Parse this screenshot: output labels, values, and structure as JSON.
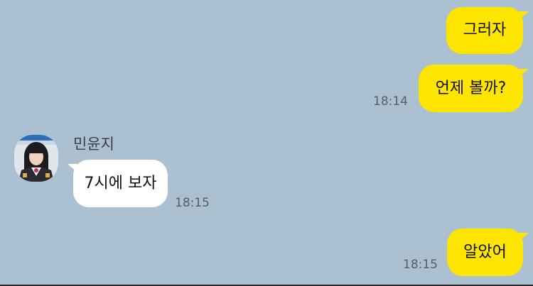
{
  "messages": {
    "m1": {
      "text": "그러자"
    },
    "m2": {
      "text": "언제 볼까?",
      "time": "18:14"
    },
    "m3": {
      "sender": "민윤지",
      "text": "7시에 보자",
      "time": "18:15"
    },
    "m4": {
      "text": "알았어",
      "time": "18:15"
    }
  },
  "colors": {
    "background": "#abc1d1",
    "my_bubble": "#fee500",
    "their_bubble": "#ffffff"
  },
  "icons": {
    "avatar": "profile-photo"
  }
}
